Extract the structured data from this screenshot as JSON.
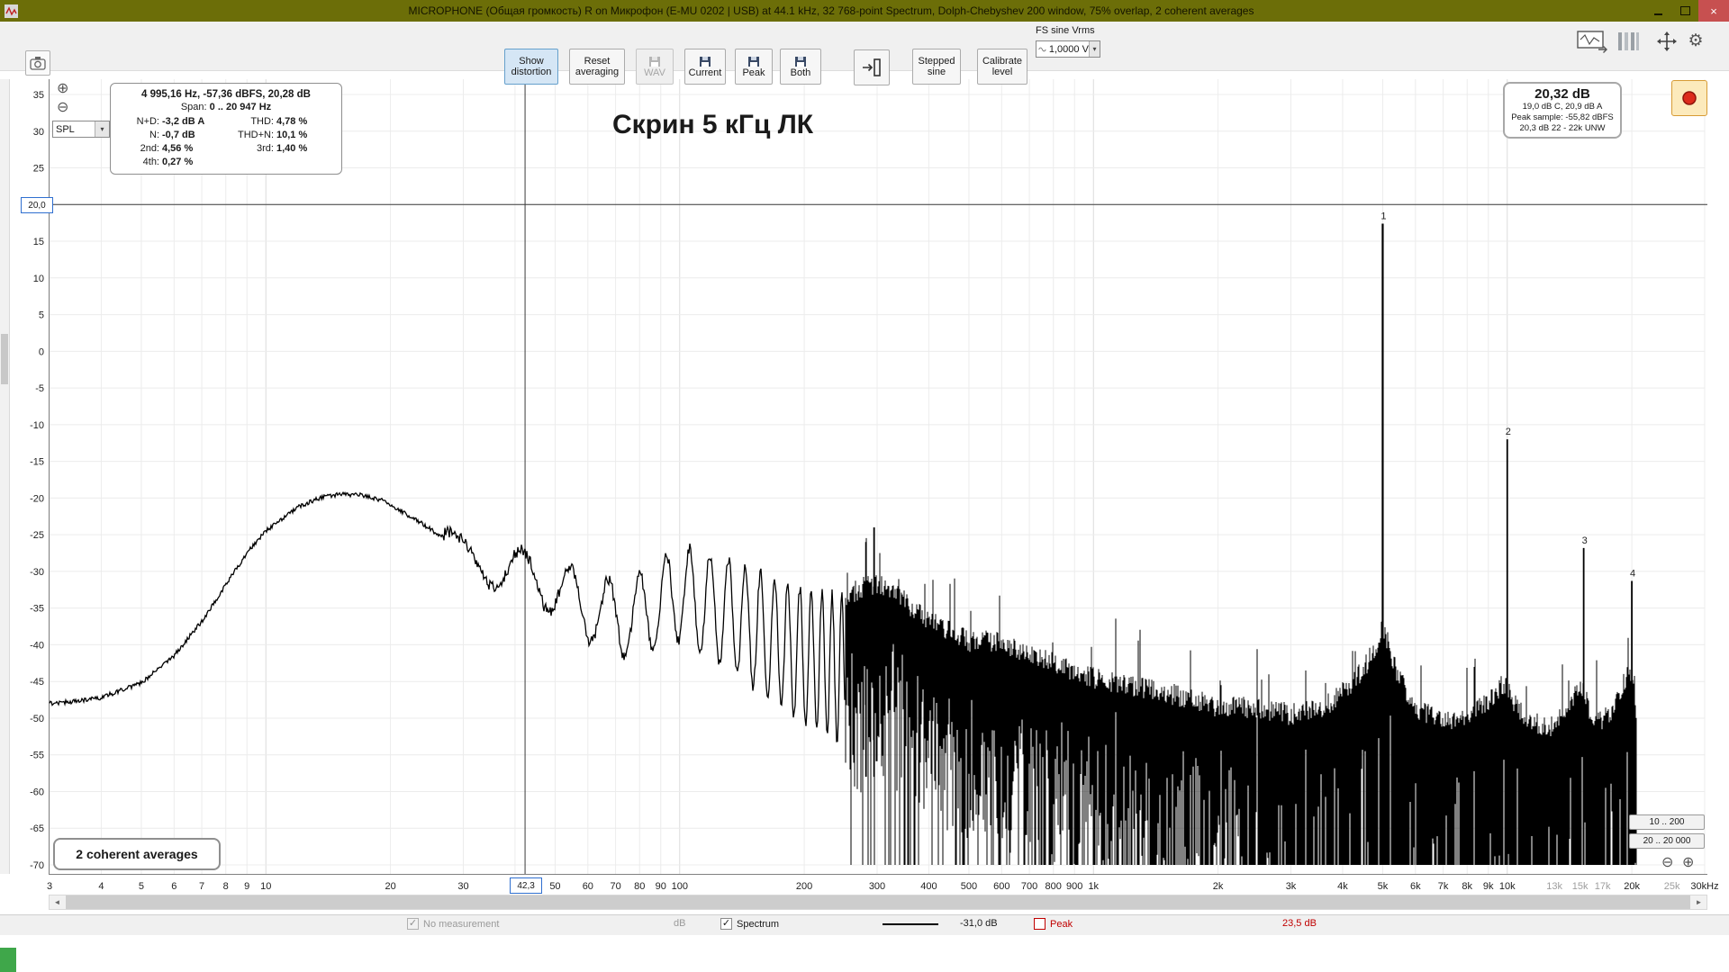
{
  "window": {
    "title": "MICROPHONE (Общая громкость) R on Микрофон (E-MU 0202 | USB) at 44.1 kHz, 32 768-point Spectrum, Dolph-Chebyshev 200 window, 75% overlap, 2 coherent averages"
  },
  "toolbar": {
    "show_distortion": "Show distortion",
    "reset_averaging": "Reset averaging",
    "wav": "WAV",
    "current": "Current",
    "peak": "Peak",
    "both": "Both",
    "stepped_sine": "Stepped sine",
    "calibrate_level": "Calibrate level",
    "fs_sine_label": "FS sine Vrms",
    "fs_sine_value": "1,0000 V"
  },
  "spl_selector": {
    "value": "SPL"
  },
  "info_panel": {
    "line1": "4 995,16 Hz, -57,36 dBFS, 20,28 dB",
    "line2_label": "Span:",
    "line2_value": "0 .. 20 947 Hz",
    "rows": [
      {
        "l1": "N+D:",
        "v1": "-3,2 dB A",
        "l2": "THD:",
        "v2": "4,78 %"
      },
      {
        "l1": "N:",
        "v1": "-0,7 dB",
        "l2": "THD+N:",
        "v2": "10,1 %"
      },
      {
        "l1": "2nd:",
        "v1": "4,56 %",
        "l2": "3rd:",
        "v2": "1,40 %"
      },
      {
        "l1": "4th:",
        "v1": "0,27 %",
        "l2": "",
        "v2": ""
      }
    ]
  },
  "annotation": "Скрин 5 кГц ЛК",
  "level_panel": {
    "value": "20,32 dB",
    "detail1": "19,0 dB C, 20,9 dB A",
    "detail2": "Peak sample: -55,82 dBFS",
    "detail3": "20,3 dB 22 - 22k UNW"
  },
  "averages_badge": "2 coherent averages",
  "range_buttons": {
    "top": "10 .. 200",
    "bottom": "20 .. 20 000"
  },
  "cursors": {
    "x": "42,3",
    "y": "20,0"
  },
  "status_bar": {
    "no_measurement": "No measurement",
    "db_label": "dB",
    "spectrum_label": "Spectrum",
    "spectrum_value": "-31,0 dB",
    "peak_label": "Peak",
    "peak_value": "23,5 dB"
  },
  "chart_data": {
    "type": "line",
    "title": "Скрин 5 кГц ЛК",
    "x_axis": {
      "scale": "log",
      "min": 3,
      "max": 30000,
      "unit": "Hz"
    },
    "y_axis": {
      "label": "SPL",
      "unit": "dB",
      "min": -70,
      "max": 35,
      "tick_step": 5
    },
    "grid": true,
    "cursor": {
      "freq_hz": 42.3,
      "label": "42,3",
      "level_db": 20,
      "level_label": "20,0"
    },
    "x_ticks": [
      {
        "f": 3,
        "label": "3"
      },
      {
        "f": 4,
        "label": "4"
      },
      {
        "f": 5,
        "label": "5"
      },
      {
        "f": 6,
        "label": "6"
      },
      {
        "f": 7,
        "label": "7"
      },
      {
        "f": 8,
        "label": "8"
      },
      {
        "f": 9,
        "label": "9"
      },
      {
        "f": 10,
        "label": "10"
      },
      {
        "f": 20,
        "label": "20"
      },
      {
        "f": 30,
        "label": "30"
      },
      {
        "f": 50,
        "label": "50"
      },
      {
        "f": 60,
        "label": "60"
      },
      {
        "f": 70,
        "label": "70"
      },
      {
        "f": 80,
        "label": "80"
      },
      {
        "f": 90,
        "label": "90"
      },
      {
        "f": 100,
        "label": "100"
      },
      {
        "f": 200,
        "label": "200"
      },
      {
        "f": 300,
        "label": "300"
      },
      {
        "f": 400,
        "label": "400"
      },
      {
        "f": 500,
        "label": "500"
      },
      {
        "f": 600,
        "label": "600"
      },
      {
        "f": 700,
        "label": "700"
      },
      {
        "f": 800,
        "label": "800"
      },
      {
        "f": 900,
        "label": "900"
      },
      {
        "f": 1000,
        "label": "1k"
      },
      {
        "f": 2000,
        "label": "2k"
      },
      {
        "f": 3000,
        "label": "3k"
      },
      {
        "f": 4000,
        "label": "4k"
      },
      {
        "f": 5000,
        "label": "5k"
      },
      {
        "f": 6000,
        "label": "6k"
      },
      {
        "f": 7000,
        "label": "7k"
      },
      {
        "f": 8000,
        "label": "8k"
      },
      {
        "f": 9000,
        "label": "9k"
      },
      {
        "f": 10000,
        "label": "10k"
      },
      {
        "f": 13000,
        "label": "13k",
        "muted": true
      },
      {
        "f": 15000,
        "label": "15k",
        "muted": true
      },
      {
        "f": 17000,
        "label": "17k",
        "muted": true
      },
      {
        "f": 20000,
        "label": "20k"
      },
      {
        "f": 25000,
        "label": "25k",
        "muted": true
      },
      {
        "f": 30000,
        "label": "30kHz"
      }
    ],
    "series": {
      "name": "Spectrum",
      "color": "#000000",
      "smooth_envelope": [
        [
          3,
          -48
        ],
        [
          3.6,
          -47.6
        ],
        [
          4,
          -47.2
        ],
        [
          5,
          -45.2
        ],
        [
          6,
          -41.5
        ],
        [
          7,
          -36.8
        ],
        [
          8,
          -31.8
        ],
        [
          9,
          -27.5
        ],
        [
          10,
          -24.5
        ],
        [
          11,
          -22.8
        ],
        [
          12,
          -21.2
        ],
        [
          13.5,
          -20
        ],
        [
          15,
          -19.5
        ],
        [
          17,
          -19.6
        ],
        [
          19,
          -20.3
        ],
        [
          21,
          -21.6
        ],
        [
          24,
          -23.6
        ],
        [
          27,
          -25.5
        ],
        [
          30,
          -27.5
        ],
        [
          35,
          -29.5
        ],
        [
          40,
          -29.8
        ],
        [
          47,
          -31.5
        ],
        [
          55,
          -33.5
        ],
        [
          65,
          -36
        ],
        [
          78,
          -36.5
        ],
        [
          90,
          -34.5
        ],
        [
          100,
          -33
        ],
        [
          115,
          -34.5
        ],
        [
          135,
          -36
        ],
        [
          160,
          -38.5
        ],
        [
          190,
          -41
        ],
        [
          220,
          -42.5
        ],
        [
          250,
          -43.5
        ]
      ],
      "comb": {
        "period_hz": 12.8,
        "f_start": 27,
        "f_end": 250,
        "amp_start": 1.5,
        "amp_end": 10
      },
      "noise_envelope": [
        [
          250,
          -35
        ],
        [
          270,
          -34
        ],
        [
          300,
          -33
        ],
        [
          340,
          -35
        ],
        [
          400,
          -38
        ],
        [
          500,
          -41
        ],
        [
          600,
          -41
        ],
        [
          700,
          -43
        ],
        [
          800,
          -44
        ],
        [
          1000,
          -46
        ],
        [
          1200,
          -47
        ],
        [
          1500,
          -48
        ],
        [
          2000,
          -50
        ],
        [
          2500,
          -50
        ],
        [
          3000,
          -51
        ],
        [
          3600,
          -50
        ],
        [
          4200,
          -47
        ],
        [
          4700,
          -43
        ],
        [
          5000,
          -39
        ],
        [
          5400,
          -45
        ],
        [
          6000,
          -50
        ],
        [
          7000,
          -52
        ],
        [
          8000,
          -52
        ],
        [
          9000,
          -49
        ],
        [
          9700,
          -47
        ],
        [
          10000,
          -47
        ],
        [
          10500,
          -50
        ],
        [
          11500,
          -52
        ],
        [
          12500,
          -53
        ],
        [
          13500,
          -51
        ],
        [
          14800,
          -48
        ],
        [
          15300,
          -48
        ],
        [
          16000,
          -51
        ],
        [
          17000,
          -52
        ],
        [
          18000,
          -50
        ],
        [
          19000,
          -47
        ],
        [
          19800,
          -45
        ],
        [
          20300,
          -47
        ],
        [
          20500,
          -50
        ]
      ],
      "noise_range": [
        250,
        20500
      ]
    },
    "peaks": [
      {
        "label": "1",
        "freq_hz": 5000,
        "db": 17.4
      },
      {
        "label": "2",
        "freq_hz": 10000,
        "db": -12.0
      },
      {
        "label": "3",
        "freq_hz": 15300,
        "db": -26.8
      },
      {
        "label": "4",
        "freq_hz": 20000,
        "db": -31.3
      },
      {
        "label": "",
        "freq_hz": 282,
        "db": -26.0,
        "bottom_db": -58
      },
      {
        "label": "",
        "freq_hz": 295,
        "db": -24.0,
        "bottom_db": -58
      }
    ]
  }
}
